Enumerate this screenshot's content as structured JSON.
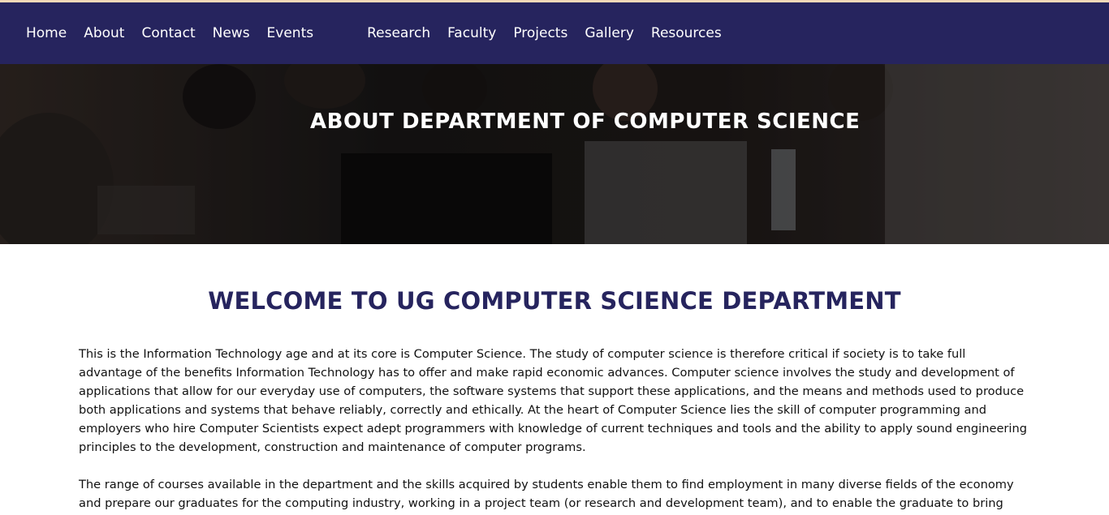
{
  "nav": {
    "items": [
      {
        "label": "Home"
      },
      {
        "label": "About"
      },
      {
        "label": "Contact"
      },
      {
        "label": "News"
      },
      {
        "label": "Events"
      },
      {
        "label": "Research"
      },
      {
        "label": "Faculty"
      },
      {
        "label": "Projects"
      },
      {
        "label": "Gallery"
      },
      {
        "label": "Resources"
      }
    ]
  },
  "hero": {
    "title": "ABOUT DEPARTMENT OF COMPUTER SCIENCE"
  },
  "main": {
    "heading": "WELCOME TO UG COMPUTER SCIENCE DEPARTMENT",
    "paragraphs": [
      "This is the Information Technology age and at its core is Computer Science. The study of computer science is therefore critical if society is to take full advantage of the benefits Information Technology has to offer and make rapid economic advances. Computer science involves the study and development of applications that allow for our everyday use of computers, the software systems that support these applications, and the means and methods used to produce both applications and systems that behave reliably, correctly and ethically. At the heart of Computer Science lies the skill of computer programming and employers who hire Computer Scientists expect adept programmers with knowledge of current techniques and tools and the ability to apply sound engineering principles to the development, construction and maintenance of computer programs.",
      "The range of courses available in the department and the skills acquired by students enable them to find employment in many diverse fields of the economy and prepare our graduates for the computing industry, working in a project team (or research and development team), and to enable the graduate to bring specialist skills to that team. The"
    ]
  },
  "colors": {
    "nav_bg": "#26245e",
    "heading": "#26245e",
    "top_accent": "#f3d9b8"
  }
}
